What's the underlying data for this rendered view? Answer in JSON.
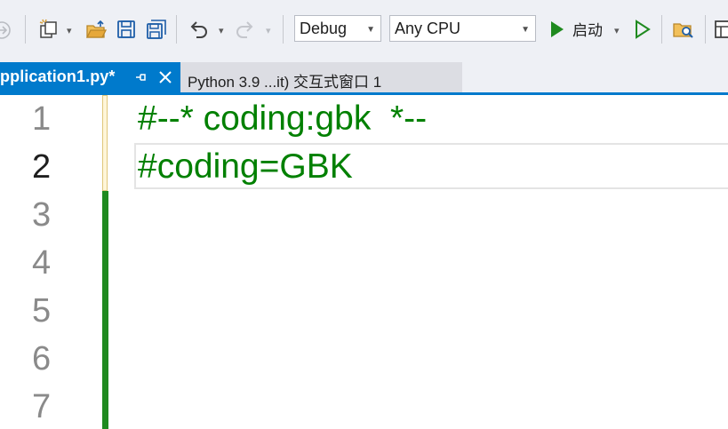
{
  "toolbar": {
    "configuration": "Debug",
    "platform": "Any CPU",
    "start_label": "启动",
    "dropdown_glyph": "▾",
    "colors": {
      "background": "#eef0f5",
      "start_green": "#1f8a1f",
      "save_blue": "#1e5ea8",
      "folder_orange": "#d8a13c"
    }
  },
  "tabs": [
    {
      "label": "pplication1.py*",
      "active": true
    },
    {
      "label": "Python 3.9 ...it) 交互式窗口 1",
      "active": false
    }
  ],
  "editor": {
    "line_numbers": [
      "1",
      "2",
      "3",
      "4",
      "5",
      "6",
      "7"
    ],
    "current_line": "2",
    "lines": [
      "#--* coding:gbk  *--",
      "#coding=GBK"
    ],
    "colors": {
      "comment": "#008000",
      "accent": "#007acc",
      "change_bar": "#1f8a1f"
    }
  }
}
